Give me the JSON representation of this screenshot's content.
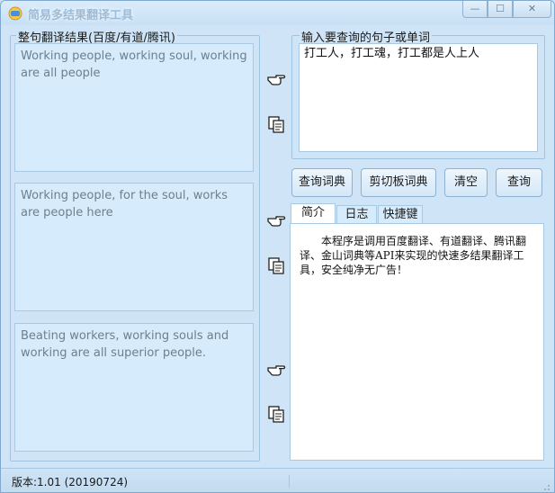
{
  "window": {
    "title": "简易多结果翻译工具",
    "controls": {
      "minimize": "—",
      "maximize": "☐",
      "close": "✕"
    }
  },
  "results_group": {
    "label": "整句翻译结果(百度/有道/腾讯)",
    "results": [
      {
        "text": "Working people, working soul, working are all people"
      },
      {
        "text": "Working people, for the soul, works are people here"
      },
      {
        "text": "Beating workers, working souls and working are all superior people."
      }
    ]
  },
  "side_icons": {
    "pointer": "pointing-hand-icon",
    "copy": "copy-icon"
  },
  "input_group": {
    "label": "输入要查询的句子或单词",
    "value": "打工人，打工魂，打工都是人上人"
  },
  "buttons": {
    "dict_query": "查询词典",
    "clipboard_dict": "剪切板词典",
    "clear": "清空",
    "query": "查询"
  },
  "tabs": [
    {
      "label": "简介",
      "active": true
    },
    {
      "label": "日志",
      "active": false
    },
    {
      "label": "快捷键",
      "active": false
    }
  ],
  "tab_content": "本程序是调用百度翻译、有道翻译、腾讯翻译、金山词典等API来实现的快速多结果翻译工具，安全纯净无广告！",
  "status": {
    "version": "版本:1.01  (20190724)"
  },
  "colors": {
    "window_bg": "#cfe5f7",
    "result_bg": "#d6ebfb",
    "border": "#a9c9e3"
  }
}
